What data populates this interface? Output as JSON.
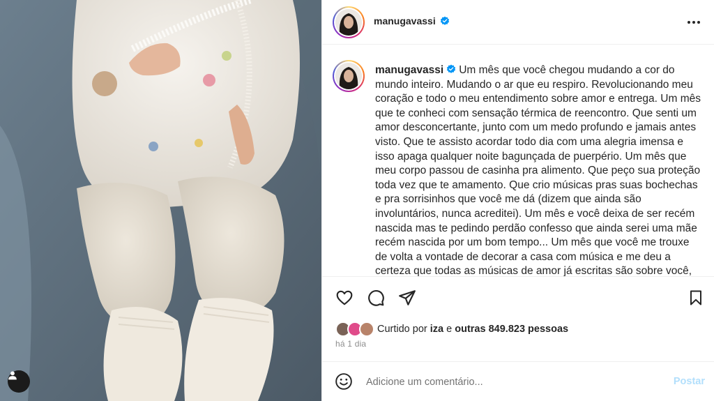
{
  "post": {
    "username": "manugavassi",
    "verified": true,
    "caption": "Um mês que você chegou mudando a cor do mundo inteiro. Mudando o ar que eu respiro. Revolucionando meu coração e todo o meu entendimento sobre amor e entrega. Um mês que te conheci com sensação térmica de reencontro. Que senti um amor desconcertante, junto com um medo profundo e jamais antes visto. Que te assisto acordar todo dia com uma alegria imensa e isso apaga qualquer noite bagunçada de puerpério. Um mês que meu corpo passou de casinha pra alimento. Que peço sua proteção toda vez que te amamento. Que crio músicas pras suas bochechas e pra sorrisinhos que você me dá (dizem que ainda são involuntários, nunca acreditei). Um mês e você deixa de ser recém nascida mas te pedindo perdão confesso que ainda serei uma mãe recém nascida por um bom tempo... Um mês que você me trouxe de volta a vontade de decorar a casa com música e me deu a certeza que todas as músicas de amor já escritas são sobre você,",
    "likes": {
      "prefix": "Curtido por",
      "user": "iza",
      "conjunction": "e",
      "others": "outras 849.823 pessoas"
    },
    "time_ago": "há 1 dia"
  },
  "comment": {
    "placeholder": "Adicione um comentário...",
    "post_label": "Postar"
  },
  "icons": {
    "more": "more-options-icon",
    "like": "heart-icon",
    "comment": "comment-icon",
    "share": "share-icon",
    "save": "bookmark-icon",
    "emoji": "emoji-icon",
    "tags": "user-tag-icon",
    "verified": "verified-badge-icon"
  },
  "colors": {
    "verified": "#0095f6",
    "post_disabled": "#b2dffc",
    "secondary_text": "#8e8e8e"
  }
}
